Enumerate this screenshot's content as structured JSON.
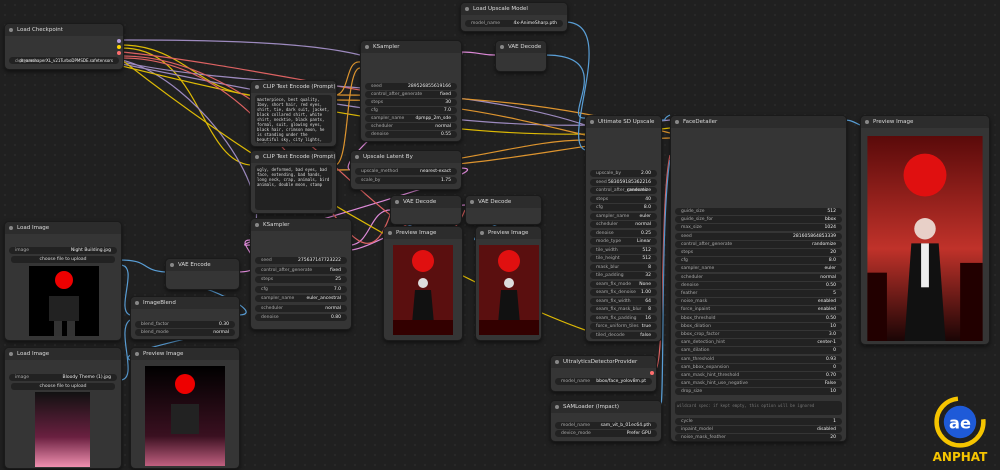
{
  "nodes": {
    "load_checkpoint": {
      "title": "Load Checkpoint",
      "ckpt_name_label": "ckpt_name",
      "ckpt_name": "dreamshaperXL_v21TurboDPMSDE.safetensors"
    },
    "load_upscale": {
      "title": "Load Upscale Model",
      "model_name_label": "model_name",
      "model_name": "4x-AnimeSharp.pth"
    },
    "ksampler1": {
      "title": "KSampler",
      "widgets": [
        {
          "k": "seed",
          "v": "289526855619166"
        },
        {
          "k": "control_after_generate",
          "v": "fixed"
        },
        {
          "k": "steps",
          "v": "30"
        },
        {
          "k": "cfg",
          "v": "7.0"
        },
        {
          "k": "sampler_name",
          "v": "dpmpp_2m_sde"
        },
        {
          "k": "scheduler",
          "v": "normal"
        },
        {
          "k": "denoise",
          "v": "0.55"
        }
      ]
    },
    "vae_decode_top": {
      "title": "VAE Decode"
    },
    "clip_pos": {
      "title": "CLIP Text Encode (Prompt)",
      "text": "masterpiece, best quality, 1boy, short hair, red eyes, shirt, tie, dark suit, jacket, black collared shirt, white shirt, necktie, black pants, formal, suit, glowing eyes, black hair, crimson moon, he is standing under the beautiful sky, city lights, buildings, night, cinematic lighting, depth of field"
    },
    "clip_neg": {
      "title": "CLIP Text Encode (Prompt)",
      "text": "ugly, deformed, bad eyes, bad face, extending, bad hands, long neck, crap, animals, bird animals, double moon, stamp"
    },
    "upscale_latent": {
      "title": "Upscale Latent By",
      "widgets": [
        {
          "k": "upscale_method",
          "v": "nearest-exact"
        },
        {
          "k": "scale_by",
          "v": "1.75"
        }
      ]
    },
    "ultimate_sd": {
      "title": "Ultimate SD Upscale",
      "widgets": [
        {
          "k": "upscale_by",
          "v": "2.00"
        },
        {
          "k": "seed",
          "v": "583059185362216"
        },
        {
          "k": "control_after_generate",
          "v": "randomize"
        },
        {
          "k": "steps",
          "v": "40"
        },
        {
          "k": "cfg",
          "v": "8.0"
        },
        {
          "k": "sampler_name",
          "v": "euler"
        },
        {
          "k": "scheduler",
          "v": "normal"
        },
        {
          "k": "denoise",
          "v": "0.25"
        },
        {
          "k": "mode_type",
          "v": "Linear"
        },
        {
          "k": "tile_width",
          "v": "512"
        },
        {
          "k": "tile_height",
          "v": "512"
        },
        {
          "k": "mask_blur",
          "v": "8"
        },
        {
          "k": "tile_padding",
          "v": "32"
        },
        {
          "k": "seam_fix_mode",
          "v": "None"
        },
        {
          "k": "seam_fix_denoise",
          "v": "1.00"
        },
        {
          "k": "seam_fix_width",
          "v": "64"
        },
        {
          "k": "seam_fix_mask_blur",
          "v": "8"
        },
        {
          "k": "seam_fix_padding",
          "v": "16"
        },
        {
          "k": "force_uniform_tiles",
          "v": "true"
        },
        {
          "k": "tiled_decode",
          "v": "false"
        }
      ]
    },
    "face_detailer": {
      "title": "FaceDetailer",
      "widgets": [
        {
          "k": "guide_size",
          "v": "512"
        },
        {
          "k": "guide_size_for",
          "v": "bbox"
        },
        {
          "k": "max_size",
          "v": "1024"
        },
        {
          "k": "seed",
          "v": "281605864853339"
        },
        {
          "k": "control_after_generate",
          "v": "randomize"
        },
        {
          "k": "steps",
          "v": "20"
        },
        {
          "k": "cfg",
          "v": "8.0"
        },
        {
          "k": "sampler_name",
          "v": "euler"
        },
        {
          "k": "scheduler",
          "v": "normal"
        },
        {
          "k": "denoise",
          "v": "0.50"
        },
        {
          "k": "feather",
          "v": "5"
        },
        {
          "k": "noise_mask",
          "v": "enabled"
        },
        {
          "k": "force_inpaint",
          "v": "enabled"
        },
        {
          "k": "bbox_threshold",
          "v": "0.50"
        },
        {
          "k": "bbox_dilation",
          "v": "10"
        },
        {
          "k": "bbox_crop_factor",
          "v": "3.0"
        },
        {
          "k": "sam_detection_hint",
          "v": "center-1"
        },
        {
          "k": "sam_dilation",
          "v": "0"
        },
        {
          "k": "sam_threshold",
          "v": "0.93"
        },
        {
          "k": "sam_bbox_expansion",
          "v": "0"
        },
        {
          "k": "sam_mask_hint_threshold",
          "v": "0.70"
        },
        {
          "k": "sam_mask_hint_use_negative",
          "v": "False"
        },
        {
          "k": "drop_size",
          "v": "10"
        }
      ],
      "wildcard_placeholder": "wildcard spec: if kept empty, this option will be ignored",
      "widgets2": [
        {
          "k": "cycle",
          "v": "1"
        },
        {
          "k": "inpaint_model",
          "v": "disabled"
        },
        {
          "k": "noise_mask_feather",
          "v": "20"
        }
      ]
    },
    "load_image1": {
      "title": "Load Image",
      "image_label": "image",
      "image": "Night Building.jpg",
      "button": "choose file to upload"
    },
    "vae_encode": {
      "title": "VAE Encode"
    },
    "ksampler2": {
      "title": "KSampler",
      "widgets": [
        {
          "k": "seed",
          "v": "275637147723222"
        },
        {
          "k": "control_after_generate",
          "v": "fixed"
        },
        {
          "k": "steps",
          "v": "25"
        },
        {
          "k": "cfg",
          "v": "7.0"
        },
        {
          "k": "sampler_name",
          "v": "euler_ancestral"
        },
        {
          "k": "scheduler",
          "v": "normal"
        },
        {
          "k": "denoise",
          "v": "0.80"
        }
      ]
    },
    "vae_decode_mid1": {
      "title": "VAE Decode"
    },
    "vae_decode_mid2": {
      "title": "VAE Decode"
    },
    "preview1": {
      "title": "Preview Image"
    },
    "preview2": {
      "title": "Preview Image"
    },
    "image_blend": {
      "title": "ImageBlend",
      "widgets": [
        {
          "k": "blend_factor",
          "v": "0.30"
        },
        {
          "k": "blend_mode",
          "v": "normal"
        }
      ]
    },
    "load_image2": {
      "title": "Load Image",
      "image_label": "image",
      "image": "Bloody Theme (1).jpg",
      "button": "choose file to upload"
    },
    "preview_blend": {
      "title": "Preview Image"
    },
    "ultra_bbox": {
      "title": "UltralyticsDetectorProvider",
      "model_name_label": "model_name",
      "model_name": "bbox/face_yolov8m.pt"
    },
    "sam_loader": {
      "title": "SAMLoader (Impact)",
      "widgets": [
        {
          "k": "model_name",
          "v": "sam_vit_b_01ec64.pth"
        },
        {
          "k": "device_mode",
          "v": "Prefer GPU"
        }
      ]
    },
    "preview_final": {
      "title": "Preview Image"
    }
  },
  "logo": {
    "text": "ANPHAT",
    "mark": "ae"
  },
  "colors": {
    "wire_model": "#b39ddb",
    "wire_clip": "#ffd500",
    "wire_vae": "#ff6e6e",
    "wire_cond": "#ffa931",
    "wire_latent": "#ff9cf9",
    "wire_image": "#64b5f6",
    "accent_green": "#4caf50"
  }
}
